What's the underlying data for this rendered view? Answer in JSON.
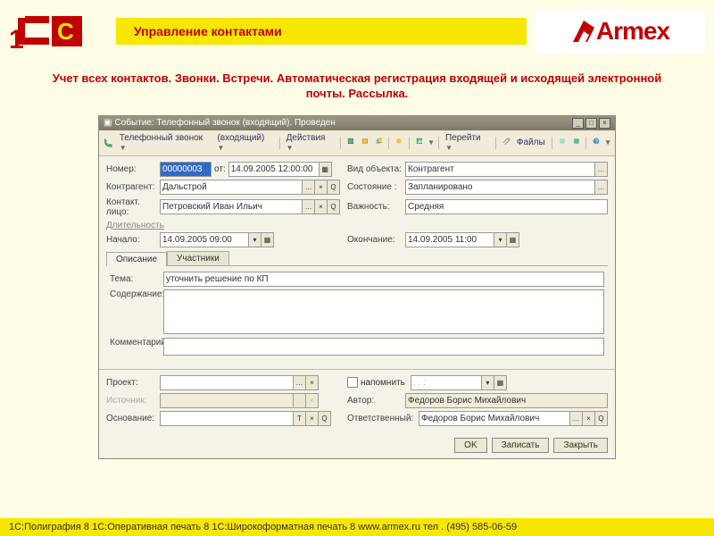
{
  "page": {
    "title": "Управление контактами",
    "subtitle": "Учет всех контактов. Звонки. Встречи. Автоматическая регистрация входящей и исходящей электронной почты. Рассылка.",
    "footer": "1С:Полиграфия 8   1С:Оперативная печать 8    1С:Широкоформатная печать 8    www.armex.ru тел . (495) 585-06-59",
    "armex": "Armex"
  },
  "win": {
    "title": "Событие: Телефонный звонок (входящий). Проведен"
  },
  "toolbar": {
    "phone": "Телефонный звонок",
    "incoming": "(входящий)",
    "actions": "Действия",
    "goto": "Перейти",
    "files": "Файлы"
  },
  "fields": {
    "number_lbl": "Номер:",
    "number_val": "00000003",
    "ot": "от:",
    "number_date": "14.09.2005 12:00:00",
    "kontragent_lbl": "Контрагент:",
    "kontragent_val": "Дальстрой",
    "contact_lbl": "Контакт. лицо:",
    "contact_val": "Петровский Иван Ильич",
    "vid_lbl": "Вид объекта:",
    "vid_val": "Контрагент",
    "state_lbl": "Состояние :",
    "state_val": "Запланировано",
    "importance_lbl": "Важность:",
    "importance_val": "Средняя",
    "duration_lbl": "Длительность",
    "start_lbl": "Начало:",
    "start_val": "14.09.2005 09:00",
    "end_lbl": "Окончание:",
    "end_val": "14.09.2005 11:00"
  },
  "tabs": {
    "desc": "Описание",
    "participants": "Участники"
  },
  "desc": {
    "tema_lbl": "Тема:",
    "tema_val": "уточнить решение по КП",
    "content_lbl": "Содержание:",
    "comment_lbl": "Комментарий:"
  },
  "bottom": {
    "project_lbl": "Проект:",
    "source_lbl": "Источник:",
    "basis_lbl": "Основание:",
    "remind": "напомнить",
    "remind_date": ". .   :",
    "author_lbl": "Автор:",
    "author_val": "Федоров Борис Михайлович",
    "resp_lbl": "Ответственный:",
    "resp_val": "Федоров Борис Михайлович"
  },
  "buttons": {
    "ok": "OK",
    "save": "Записать",
    "close": "Закрыть"
  },
  "colors": {
    "accent": "#c00000",
    "yellow": "#f7e600"
  }
}
